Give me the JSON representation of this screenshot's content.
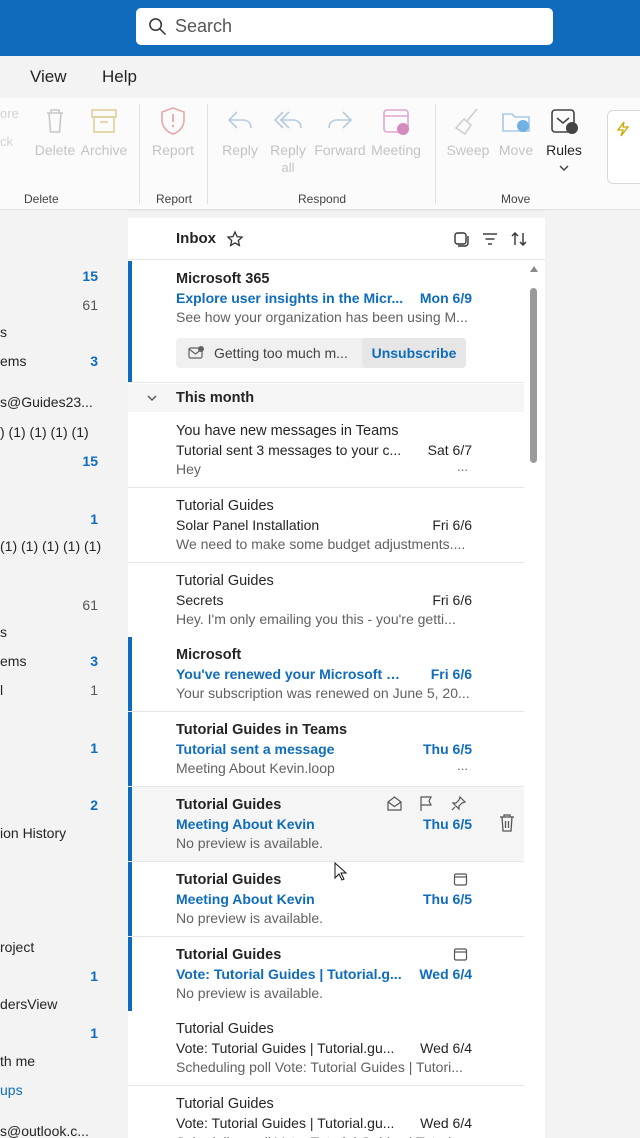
{
  "search": {
    "placeholder": "Search"
  },
  "menu": [
    {
      "label": "View"
    },
    {
      "label": "Help"
    }
  ],
  "ribbon": {
    "faded_left": [
      "ore",
      "ck"
    ],
    "buttons": {
      "delete": "Delete",
      "archive": "Archive",
      "report": "Report",
      "reply": "Reply",
      "reply_all_line1": "Reply",
      "reply_all_line2": "all",
      "forward": "Forward",
      "meeting": "Meeting",
      "sweep": "Sweep",
      "move": "Move",
      "rules": "Rules"
    },
    "groups": {
      "delete": "Delete",
      "report": "Report",
      "respond": "Respond",
      "move": "Move"
    }
  },
  "folders": [
    {
      "label": "",
      "count": "15",
      "highlight": true
    },
    {
      "label": "",
      "count": "61",
      "highlight": false
    },
    {
      "label": "s",
      "count": "",
      "highlight": false
    },
    {
      "label": "ems",
      "count": "3",
      "highlight": true
    },
    {
      "label": "s@Guides23...",
      "count": "",
      "highlight": false
    },
    {
      "label": ") (1) (1) (1) (1)",
      "count": "",
      "highlight": false
    },
    {
      "label": "",
      "count": "15",
      "highlight": true
    },
    {
      "label": "",
      "count": "1",
      "highlight": true
    },
    {
      "label": "(1) (1) (1) (1) (1)",
      "count": "",
      "highlight": false
    },
    {
      "label": "",
      "count": "61",
      "highlight": false
    },
    {
      "label": "s",
      "count": "",
      "highlight": false
    },
    {
      "label": "ems",
      "count": "3",
      "highlight": true
    },
    {
      "label": "l",
      "count": "1",
      "highlight": false
    },
    {
      "label": "",
      "count": "1",
      "highlight": true
    },
    {
      "label": "",
      "count": "2",
      "highlight": true
    },
    {
      "label": "ion History",
      "count": "",
      "highlight": false
    },
    {
      "label": "roject",
      "count": "",
      "highlight": false
    },
    {
      "label": "",
      "count": "1",
      "highlight": true
    },
    {
      "label": "dersView",
      "count": "",
      "highlight": false
    },
    {
      "label": "",
      "count": "1",
      "highlight": true
    },
    {
      "label": "th me",
      "count": "",
      "highlight": false
    },
    {
      "label": "ups",
      "count": "",
      "highlight": false
    },
    {
      "label": "s@outlook.c...",
      "count": "",
      "highlight": false
    }
  ],
  "inbox": {
    "title": "Inbox"
  },
  "pinned_message": {
    "sender": "Microsoft 365",
    "subject": "Explore user insights in the Micr...",
    "date": "Mon 6/9",
    "preview": "See how your organization has been using M...",
    "unsubscribe_text": "Getting too much m...",
    "unsubscribe_button": "Unsubscribe"
  },
  "section_label": "This month",
  "messages": [
    {
      "sender": "You have new messages in Teams",
      "subject": "Tutorial sent 3 messages to your c...",
      "date": "Sat 6/7",
      "preview": "Hey",
      "dots": "...",
      "unread": false
    },
    {
      "sender": "Tutorial Guides",
      "subject": "Solar Panel Installation",
      "date": "Fri 6/6",
      "preview": "We need to make some budget adjustments....",
      "dots": "",
      "unread": false
    },
    {
      "sender": "Tutorial Guides",
      "subject": "Secrets",
      "date": "Fri 6/6",
      "preview": "Hey. I'm only emailing you this - you're getti...",
      "dots": "",
      "unread": false
    },
    {
      "sender": "Microsoft",
      "subject": "You've renewed your Microsoft 36...",
      "date": "Fri 6/6",
      "preview": "Your subscription was renewed on June 5, 20...",
      "dots": "",
      "unread": true
    },
    {
      "sender": "Tutorial Guides in Teams",
      "subject": "Tutorial sent a message",
      "date": "Thu 6/5",
      "preview": "Meeting About Kevin.loop",
      "dots": "...",
      "unread": true
    },
    {
      "sender": "Tutorial Guides",
      "subject": "Meeting About Kevin",
      "date": "Thu 6/5",
      "preview": "No preview is available.",
      "dots": "",
      "unread": true
    },
    {
      "sender": "Tutorial Guides",
      "subject": "Meeting About Kevin",
      "date": "Thu 6/5",
      "preview": "No preview is available.",
      "dots": "",
      "unread": true
    },
    {
      "sender": "Tutorial Guides",
      "subject": "Vote: Tutorial Guides | Tutorial.g...",
      "date": "Wed 6/4",
      "preview": "No preview is available.",
      "dots": "",
      "unread": true
    },
    {
      "sender": "Tutorial Guides",
      "subject": "Vote: Tutorial Guides | Tutorial.gu...",
      "date": "Wed 6/4",
      "preview": "Scheduling poll Vote: Tutorial Guides | Tutori...",
      "dots": "",
      "unread": false
    },
    {
      "sender": "Tutorial Guides",
      "subject": "Vote: Tutorial Guides | Tutorial.gu...",
      "date": "Wed 6/4",
      "preview": "Scheduling poll Vote: Tutorial Guides | Tutori...",
      "dots": "",
      "unread": false
    }
  ],
  "colors": {
    "accent": "#0f6cbd",
    "background": "#f3f3f3"
  }
}
